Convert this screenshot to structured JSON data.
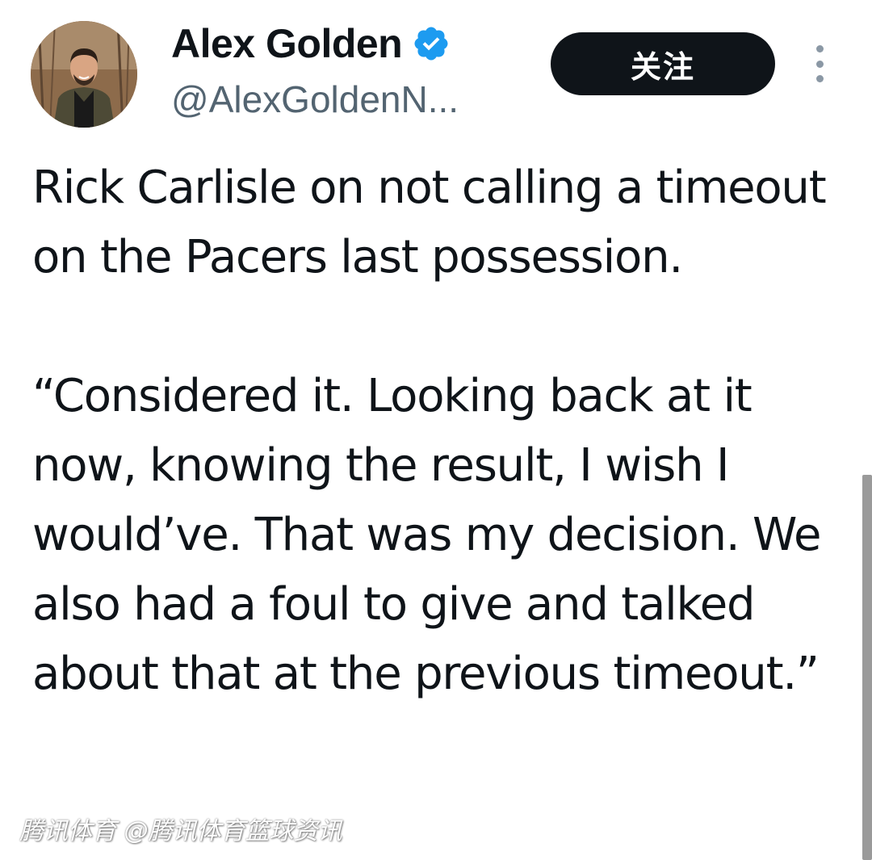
{
  "author": {
    "display_name": "Alex Golden",
    "handle": "@AlexGoldenN...",
    "verified": true,
    "verified_icon": "verified-badge-icon",
    "verified_color": "#1d9bf0",
    "avatar_icon": "avatar-photo"
  },
  "actions": {
    "follow_label": "关注",
    "more_icon": "vertical-ellipsis-icon"
  },
  "tweet": {
    "text": "Rick Carlisle on not calling a timeout on the Pacers last possession.\n\n“Considered it. Looking back at it now, knowing the result, I wish I would’ve. That was my decision. We also had a foul to give and talked about that at the previous timeout.”"
  },
  "watermark": {
    "text": "腾讯体育 @腾讯体育篮球资讯"
  },
  "colors": {
    "text": "#0f1419",
    "secondary_text": "#536471",
    "follow_button_bg": "#0f1419",
    "follow_button_text": "#ffffff",
    "verified_blue": "#1d9bf0"
  }
}
